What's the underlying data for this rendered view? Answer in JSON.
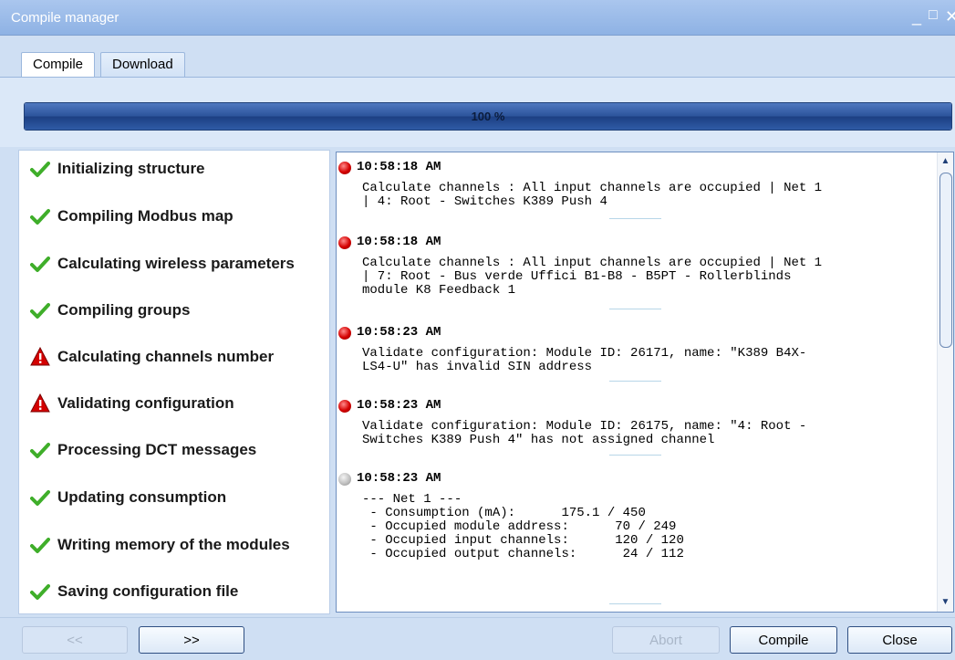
{
  "window": {
    "title": "Compile manager",
    "controls": {
      "minimize": "_",
      "maximize": "□",
      "close": "✕"
    }
  },
  "tabs": [
    {
      "label": "Compile",
      "active": true
    },
    {
      "label": "Download",
      "active": false
    }
  ],
  "progress": {
    "value_percent": 100,
    "label": "100 %"
  },
  "steps": [
    {
      "label": "Initializing structure",
      "status": "ok"
    },
    {
      "label": "Compiling Modbus map",
      "status": "ok"
    },
    {
      "label": "Calculating wireless parameters",
      "status": "ok"
    },
    {
      "label": "Compiling groups",
      "status": "ok"
    },
    {
      "label": "Calculating channels number",
      "status": "warning"
    },
    {
      "label": "Validating configuration",
      "status": "warning"
    },
    {
      "label": "Processing DCT messages",
      "status": "ok"
    },
    {
      "label": "Updating consumption",
      "status": "ok"
    },
    {
      "label": "Writing memory of the modules",
      "status": "ok"
    },
    {
      "label": "Saving configuration file",
      "status": "ok"
    }
  ],
  "log": [
    {
      "level": "error",
      "time": "10:58:18 AM",
      "message": "Calculate channels : All input channels are occupied | Net 1\n| 4: Root - Switches K389 Push 4"
    },
    {
      "level": "error",
      "time": "10:58:18 AM",
      "message": "Calculate channels : All input channels are occupied | Net 1\n| 7: Root - Bus verde Uffici B1-B8 - B5PT - Rollerblinds\nmodule K8 Feedback 1"
    },
    {
      "level": "error",
      "time": "10:58:23 AM",
      "message": "Validate configuration: Module ID: 26171, name: \"K389 B4X-\nLS4-U\" has invalid SIN address"
    },
    {
      "level": "error",
      "time": "10:58:23 AM",
      "message": "Validate configuration: Module ID: 26175, name: \"4: Root -\nSwitches K389 Push 4\" has not assigned channel"
    },
    {
      "level": "info",
      "time": "10:58:23 AM",
      "message": "--- Net 1 ---\n - Consumption (mA):      175.1 / 450\n - Occupied module address:      70 / 249\n - Occupied input channels:      120 / 120\n - Occupied output channels:      24 / 112"
    }
  ],
  "footer": {
    "prev_label": "<<",
    "next_label": ">>",
    "abort_label": "Abort",
    "compile_label": "Compile",
    "close_label": "Close"
  },
  "colors": {
    "ok_check": "#3fae2a",
    "warning_red": "#d40000",
    "progress_fill": "#2b539b"
  },
  "icons": {
    "ok": "check-icon",
    "warning": "warning-triangle-icon",
    "error": "error-dot-icon",
    "info": "info-dot-icon"
  }
}
